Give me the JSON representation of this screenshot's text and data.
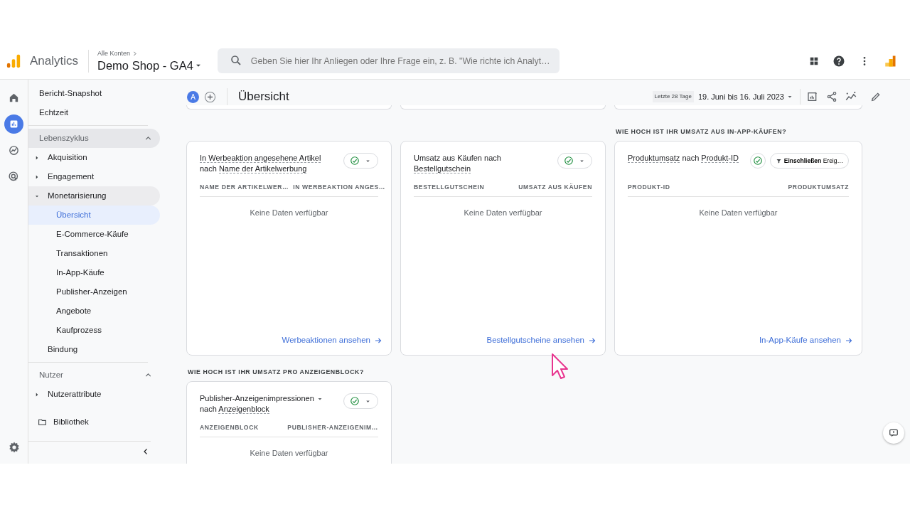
{
  "header": {
    "product": "Analytics",
    "breadcrumb": "Alle Konten",
    "property": "Demo Shop - GA4",
    "search": {
      "placeholder": "Geben Sie hier Ihr Anliegen oder Ihre Frage ein, z. B. \"Wie richte ich Analyt…"
    }
  },
  "rail": [
    {
      "kind": "home",
      "selected": false
    },
    {
      "kind": "reports",
      "selected": true
    },
    {
      "kind": "explore",
      "selected": false
    },
    {
      "kind": "advertising",
      "selected": false
    }
  ],
  "sidebar": {
    "items": [
      {
        "label": "Bericht-Snapshot",
        "selected": false
      },
      {
        "label": "Echtzeit",
        "selected": false
      }
    ],
    "sections": [
      {
        "title": "Lebenszyklus",
        "expanded": true,
        "hovered": true,
        "items": [
          {
            "label": "Akquisition",
            "expanded": false
          },
          {
            "label": "Engagement",
            "expanded": false
          },
          {
            "label": "Monetarisierung",
            "expanded": true,
            "children": [
              {
                "label": "Übersicht",
                "selected": true
              },
              {
                "label": "E-Commerce-Käufe",
                "selected": false
              },
              {
                "label": "Transaktionen",
                "selected": false
              },
              {
                "label": "In-App-Käufe",
                "selected": false
              },
              {
                "label": "Publisher-Anzeigen",
                "selected": false
              },
              {
                "label": "Angebote",
                "selected": false
              },
              {
                "label": "Kaufprozess",
                "selected": false
              }
            ]
          },
          {
            "label": "Bindung",
            "selected": false
          }
        ]
      },
      {
        "title": "Nutzer",
        "expanded": true,
        "hovered": false,
        "items": [
          {
            "label": "Nutzerattribute",
            "expanded": false
          }
        ]
      }
    ],
    "library": "Bibliothek"
  },
  "toolbar": {
    "avatar": "A",
    "title": "Übersicht",
    "range_chip": "Letzte 28 Tage",
    "date_range": "19. Juni bis 16. Juli 2023"
  },
  "rows": [
    {
      "cards": [
        {
          "metric": "In Werbeaktion angesehene Artikel",
          "connector": "nach",
          "dimension": "Name der Artikelwerbung",
          "metric_dropdown": false,
          "status_caret": true,
          "columns": [
            "NAME DER ARTIKELWER…",
            "IN WERBEAKTION ANGES…"
          ],
          "empty": "Keine Daten verfügbar",
          "link": "Werbeaktionen ansehen"
        },
        {
          "metric": "Umsatz aus Käufen nach",
          "dimension": "Bestellgutschein",
          "metric_dropdown": false,
          "status_caret": true,
          "columns": [
            "BESTELLGUTSCHEIN",
            "UMSATZ AUS KÄUFEN"
          ],
          "empty": "Keine Daten verfügbar",
          "link": "Bestellgutscheine ansehen"
        },
        {
          "heading": "WIE HOCH IST IHR UMSATZ AUS IN-APP-KÄUFEN?",
          "metric": "Produktumsatz",
          "connector": "nach",
          "dimension": "Produkt-ID",
          "metric_dropdown": false,
          "status_caret": false,
          "filter": "**Einschließen** Ereig…",
          "columns": [
            "PRODUKT-ID",
            "PRODUKTUMSATZ"
          ],
          "empty": "Keine Daten verfügbar",
          "link": "In-App-Käufe ansehen"
        }
      ]
    },
    {
      "cards": [
        {
          "heading": "WIE HOCH IST IHR UMSATZ PRO ANZEIGENBLOCK?",
          "metric": "Publisher-Anzeigenimpressionen",
          "connector": "nach",
          "dimension": "Anzeigenblock",
          "metric_dropdown": true,
          "status_caret": true,
          "columns": [
            "ANZEIGENBLOCK",
            "PUBLISHER-ANZEIGENIM…"
          ],
          "empty": "Keine Daten verfügbar"
        }
      ]
    }
  ]
}
